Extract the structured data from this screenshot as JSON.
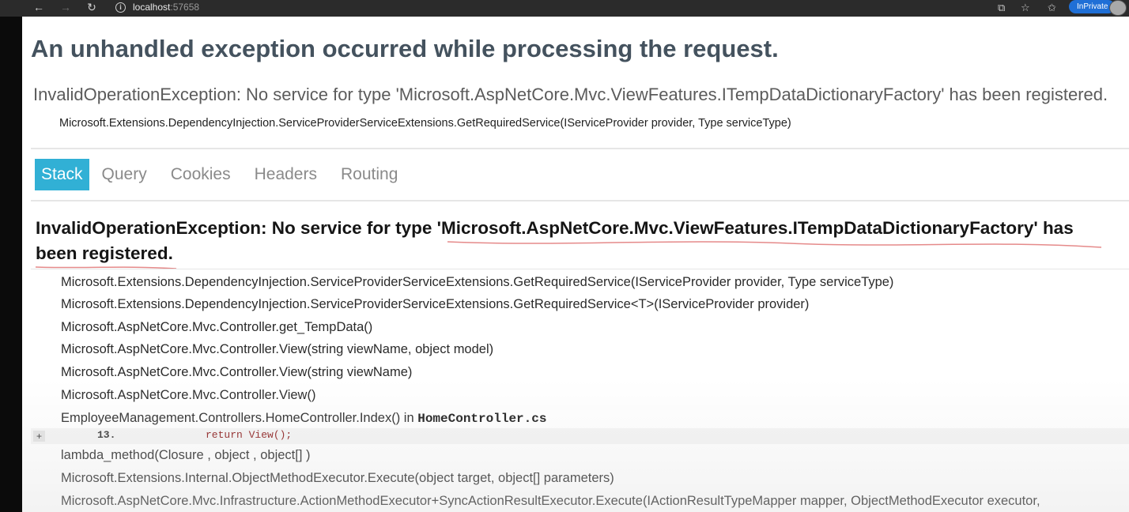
{
  "browser": {
    "url_host": "localhost",
    "url_port": ":57658",
    "inprivate_label": "InPrivate"
  },
  "page": {
    "title": "An unhandled exception occurred while processing the request.",
    "exception_summary": "InvalidOperationException: No service for type 'Microsoft.AspNetCore.Mvc.ViewFeatures.ITempDataDictionaryFactory' has been registered.",
    "exception_location": "Microsoft.Extensions.DependencyInjection.ServiceProviderServiceExtensions.GetRequiredService(IServiceProvider provider, Type serviceType)"
  },
  "tabs": [
    {
      "label": "Stack",
      "active": true
    },
    {
      "label": "Query",
      "active": false
    },
    {
      "label": "Cookies",
      "active": false
    },
    {
      "label": "Headers",
      "active": false
    },
    {
      "label": "Routing",
      "active": false
    }
  ],
  "stack": {
    "title_line1": "InvalidOperationException: No service for type 'Microsoft.AspNetCore.Mvc.ViewFeatures.ITempDataDictionaryFactory' has",
    "title_line2": "been registered.",
    "frames": [
      "Microsoft.Extensions.DependencyInjection.ServiceProviderServiceExtensions.GetRequiredService(IServiceProvider provider, Type serviceType)",
      "Microsoft.Extensions.DependencyInjection.ServiceProviderServiceExtensions.GetRequiredService<T>(IServiceProvider provider)",
      "Microsoft.AspNetCore.Mvc.Controller.get_TempData()",
      "Microsoft.AspNetCore.Mvc.Controller.View(string viewName, object model)",
      "Microsoft.AspNetCore.Mvc.Controller.View(string viewName)",
      "Microsoft.AspNetCore.Mvc.Controller.View()"
    ],
    "user_frame": {
      "method": "EmployeeManagement.Controllers.HomeController.Index() in ",
      "file": "HomeController.cs"
    },
    "code": {
      "expand_label": "+",
      "line_number": "13.",
      "text": "return View();"
    },
    "frames_after": [
      "lambda_method(Closure , object , object[] )",
      "Microsoft.Extensions.Internal.ObjectMethodExecutor.Execute(object target, object[] parameters)",
      "Microsoft.AspNetCore.Mvc.Infrastructure.ActionMethodExecutor+SyncActionResultExecutor.Execute(IActionResultTypeMapper mapper, ObjectMethodExecutor executor,"
    ]
  },
  "colors": {
    "active_tab": "#31b0d5",
    "annotation_underline": "#e58a8a",
    "title_text": "#44525e"
  }
}
